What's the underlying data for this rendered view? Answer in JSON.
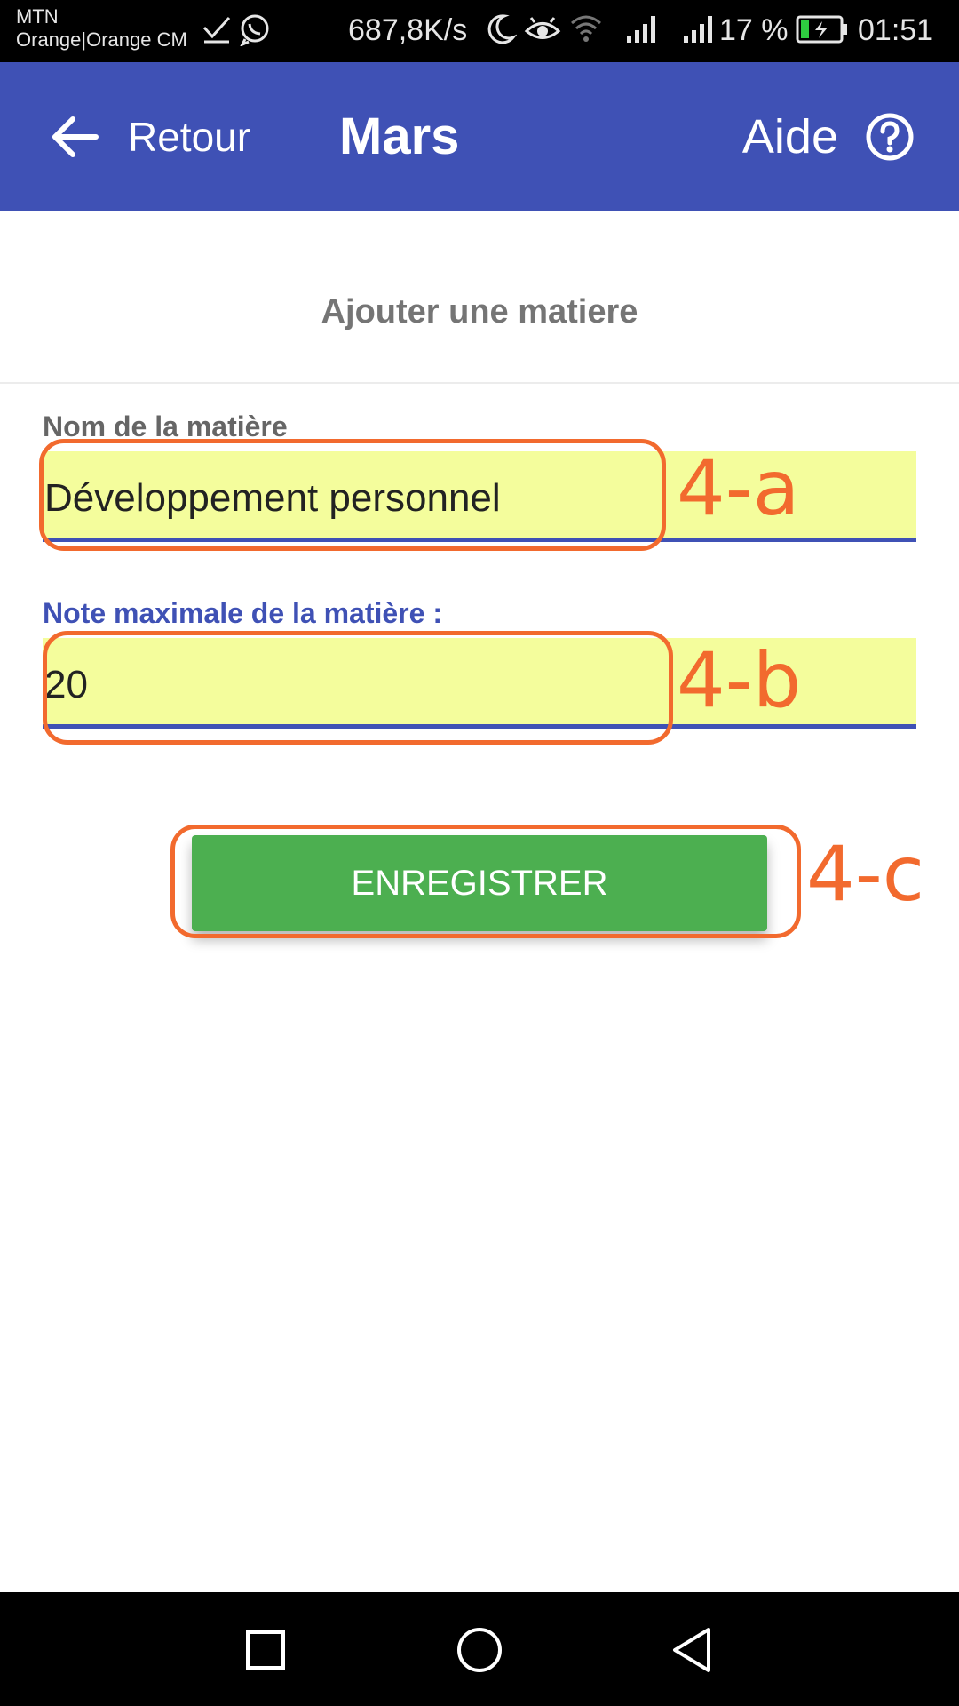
{
  "status_bar": {
    "carrier_line1": "MTN",
    "carrier_line2": "Orange|Orange CM",
    "speed": "687,8K/s",
    "battery_percent": "17 %",
    "time": "01:51",
    "icons": [
      "check-icon",
      "whatsapp-icon",
      "moon-icon",
      "eye-icon",
      "wifi-icon",
      "signal-icon",
      "signal-icon",
      "battery-charging-icon"
    ]
  },
  "app_bar": {
    "back_label": "Retour",
    "title": "Mars",
    "help_label": "Aide",
    "background": "#3f51b5"
  },
  "form": {
    "title": "Ajouter une matiere",
    "name_label": "Nom de la matière",
    "name_value": "Développement personnel",
    "max_label": "Note maximale de la matière :",
    "max_value": "20",
    "field_background": "#f4fd9c",
    "save_label": "ENREGISTRER",
    "save_color": "#4caf50"
  },
  "annotations": {
    "color": "#f26a2e",
    "a": "4-a",
    "b": "4-b",
    "c": "4-c"
  },
  "nav_bar": {
    "icons": [
      "recents-icon",
      "home-icon",
      "back-icon"
    ]
  }
}
